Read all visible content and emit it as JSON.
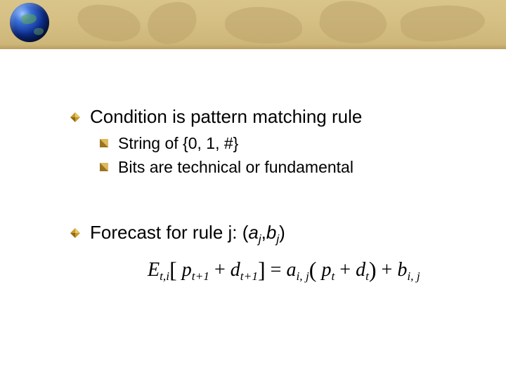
{
  "bullets": {
    "condition": "Condition is pattern matching rule",
    "string_of": "String of {0, 1, #}",
    "bits": "Bits are technical or fundamental",
    "forecast_prefix": "Forecast for rule j: (",
    "forecast_a": "a",
    "forecast_jcomma": "j",
    "forecast_comma": ",",
    "forecast_b": "b",
    "forecast_j2": "j",
    "forecast_suffix": ")"
  },
  "formula": {
    "E": "E",
    "E_sub": "t,i",
    "lb": "[",
    "p1": "p",
    "p1_sub": "t+1",
    "plus1": " + ",
    "d1": "d",
    "d1_sub": "t+1",
    "rb": "]",
    "eq": " = ",
    "a": "a",
    "a_sub": "i, j",
    "lp": "(",
    "p2": "p",
    "p2_sub": "t",
    "plus2": " + ",
    "d2": "d",
    "d2_sub": "t",
    "rp": ")",
    "plus3": " + ",
    "b": "b",
    "b_sub": "i, j"
  }
}
